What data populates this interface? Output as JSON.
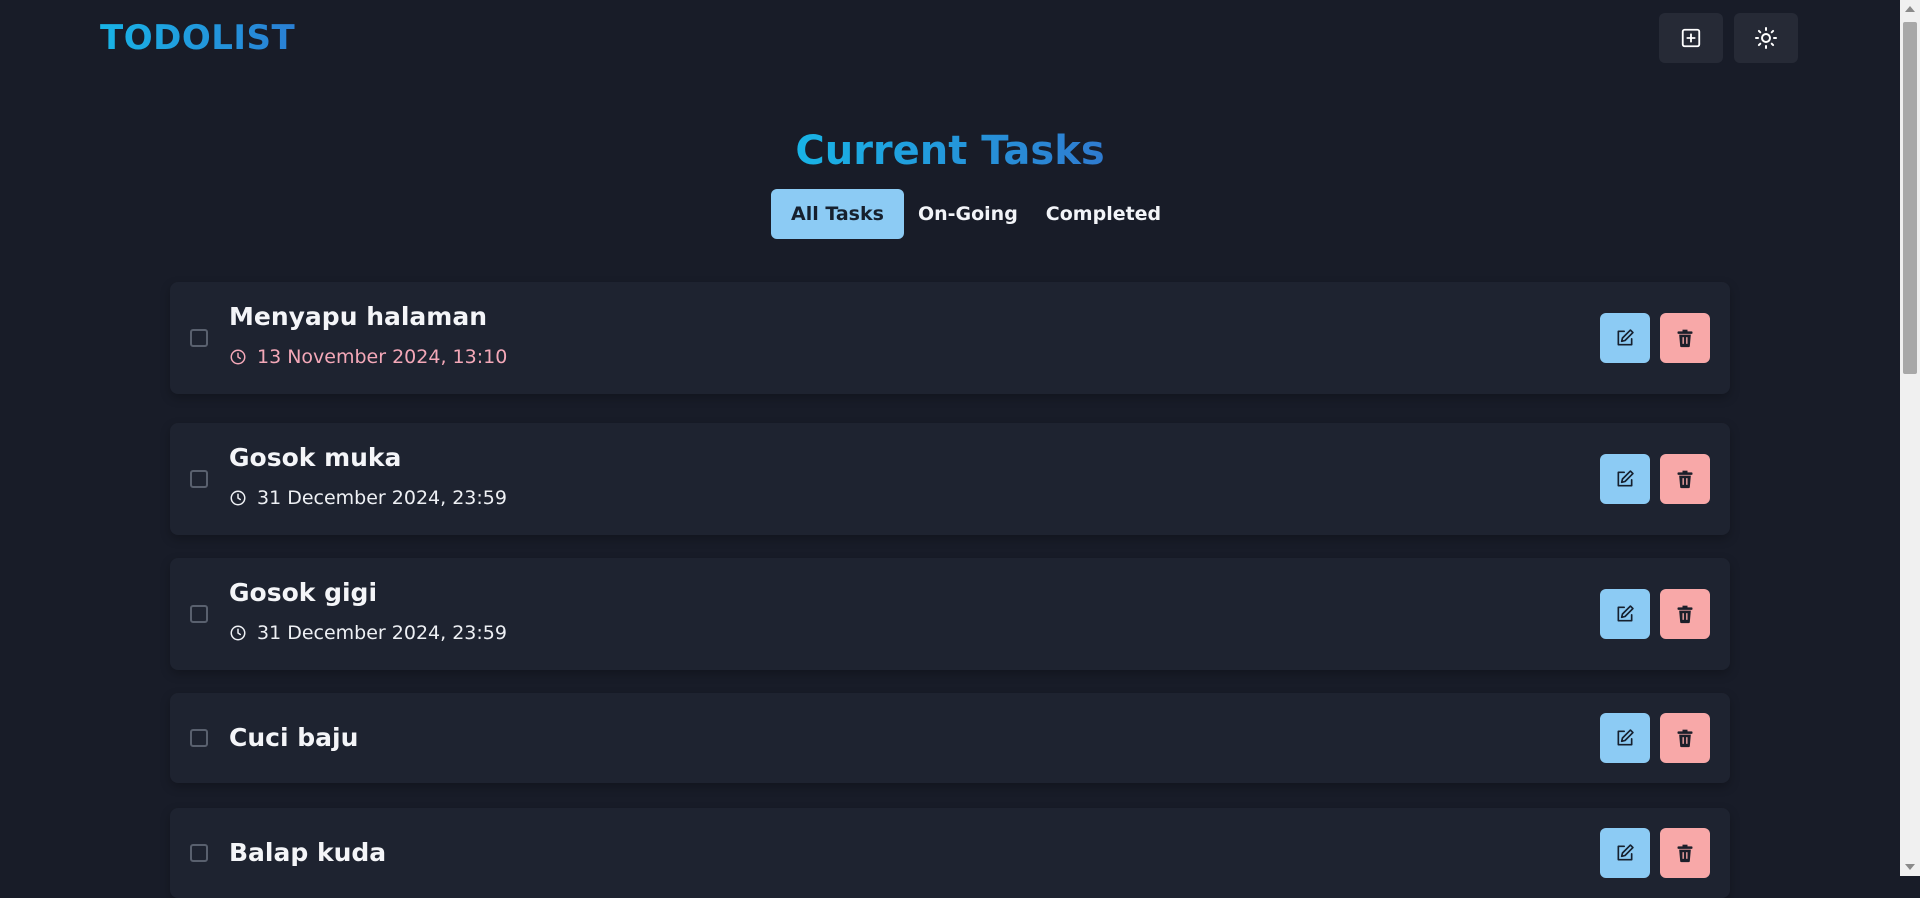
{
  "app": {
    "logo": "TODOLIST"
  },
  "header": {
    "add_button_icon": "plus-square-icon",
    "theme_button_icon": "sun-icon"
  },
  "main": {
    "title": "Current Tasks",
    "tabs": [
      {
        "label": "All Tasks",
        "active": true
      },
      {
        "label": "On-Going",
        "active": false
      },
      {
        "label": "Completed",
        "active": false
      }
    ]
  },
  "tasks": [
    {
      "title": "Menyapu halaman",
      "date": "13 November 2024, 13:10",
      "overdue": true
    },
    {
      "title": "Gosok muka",
      "date": "31 December 2024, 23:59",
      "overdue": false
    },
    {
      "title": "Gosok gigi",
      "date": "31 December 2024, 23:59",
      "overdue": false
    },
    {
      "title": "Cuci baju",
      "date": "",
      "overdue": false
    },
    {
      "title": "Balap kuda",
      "date": "",
      "overdue": false
    }
  ],
  "colors": {
    "accent": "#18b4e6",
    "edit_button": "#8ccbf4",
    "delete_button": "#f8a8a8",
    "overdue_date": "#f4a8b8",
    "normal_date": "#eef0f4"
  }
}
